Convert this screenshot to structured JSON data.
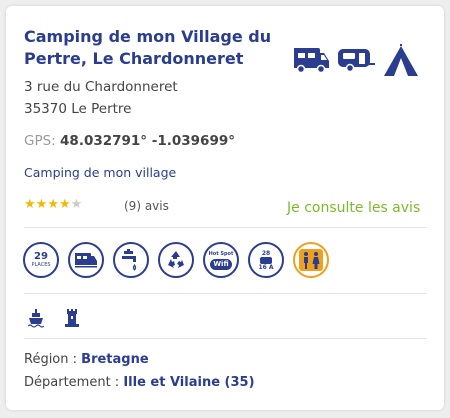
{
  "listing": {
    "title": "Camping de mon Village du Pertre, Le Chardonneret",
    "type_icons": [
      "camping-car-icon",
      "caravan-icon",
      "tent-icon"
    ],
    "address_line1": "3 rue du Chardonneret",
    "address_line2": "35370 Le Pertre",
    "gps_label": "GPS:",
    "gps_value": "48.032791° -1.039699°",
    "brand_link": "Camping de mon village",
    "rating": {
      "value": 4,
      "max": 5,
      "reviews_text": "(9) avis"
    },
    "consult_link": "Je consulte les avis",
    "services": {
      "places_number": "29",
      "places_label": "PLACES",
      "wifi_top": "Hot Spot",
      "wifi_label": "Wifi",
      "electric_top": "28",
      "electric_bottom": "16 A",
      "icons": [
        "places-icon",
        "camping-car-service-icon",
        "water-tap-icon",
        "recycling-icon",
        "wifi-hotspot-icon",
        "electric-plug-icon",
        "toilets-icon"
      ]
    },
    "activities_icons": [
      "boat-icon",
      "tower-icon"
    ],
    "region_label": "Région :",
    "region_value": "Bretagne",
    "departement_label": "Département :",
    "departement_value": "Ille et Vilaine (35)"
  },
  "colors": {
    "brand_blue": "#2a3d8f",
    "star_filled": "#f5b800",
    "star_empty": "#cccccc",
    "consult_green": "#7dba28",
    "toilet_orange": "#f0a020"
  }
}
